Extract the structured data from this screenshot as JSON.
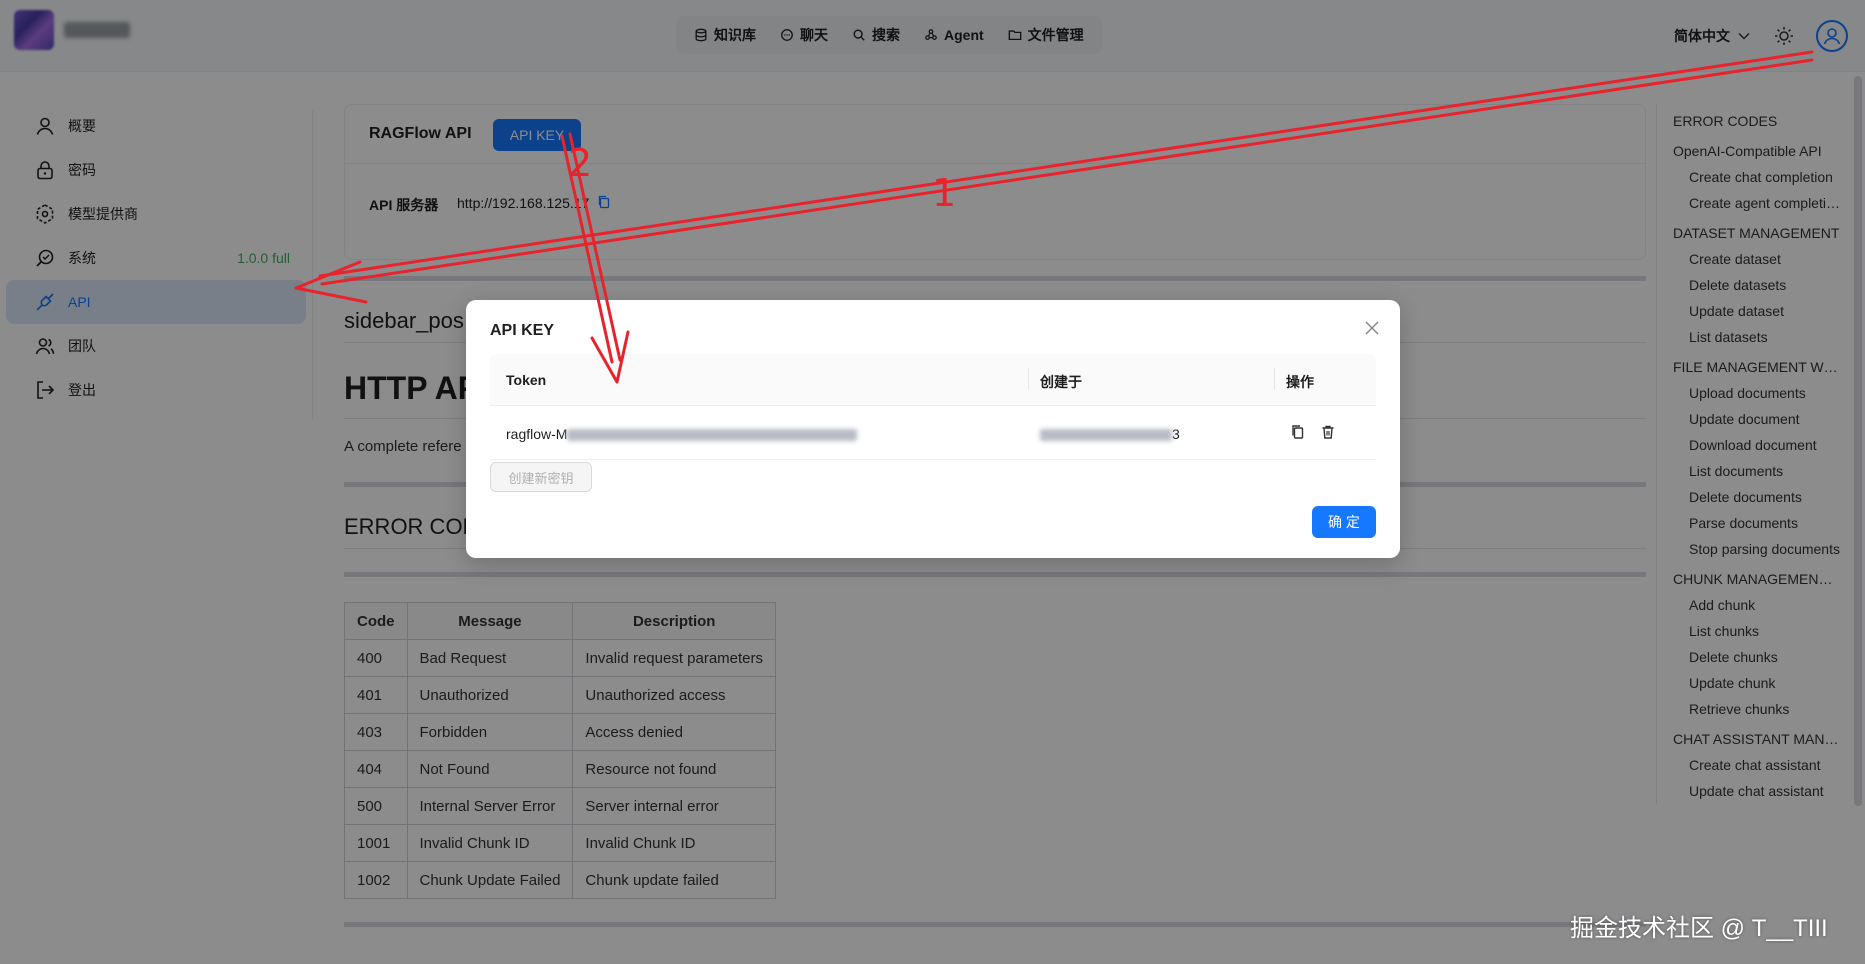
{
  "header": {
    "nav": [
      {
        "label": "知识库",
        "icon": "database-icon"
      },
      {
        "label": "聊天",
        "icon": "chat-icon"
      },
      {
        "label": "搜索",
        "icon": "search-icon"
      },
      {
        "label": "Agent",
        "icon": "agent-icon"
      },
      {
        "label": "文件管理",
        "icon": "folder-icon"
      }
    ],
    "language": "简体中文"
  },
  "sidebar": {
    "items": [
      {
        "label": "概要",
        "icon": "user-icon"
      },
      {
        "label": "密码",
        "icon": "lock-icon"
      },
      {
        "label": "模型提供商",
        "icon": "model-icon"
      },
      {
        "label": "系统",
        "icon": "system-icon",
        "badge": "1.0.0 full"
      },
      {
        "label": "API",
        "icon": "api-icon",
        "active": true
      },
      {
        "label": "团队",
        "icon": "team-icon"
      },
      {
        "label": "登出",
        "icon": "logout-icon"
      }
    ]
  },
  "api_card": {
    "title": "RAGFlow API",
    "key_button": "API KEY",
    "server_label": "API 服务器",
    "server_url": "http://192.168.125.17"
  },
  "content": {
    "sidebar_heading": "sidebar_pos",
    "http_heading": "HTTP AP",
    "intro": "A complete refere",
    "error_heading": "ERROR COD",
    "table": {
      "headers": [
        "Code",
        "Message",
        "Description"
      ],
      "rows": [
        [
          "400",
          "Bad Request",
          "Invalid request parameters"
        ],
        [
          "401",
          "Unauthorized",
          "Unauthorized access"
        ],
        [
          "403",
          "Forbidden",
          "Access denied"
        ],
        [
          "404",
          "Not Found",
          "Resource not found"
        ],
        [
          "500",
          "Internal Server Error",
          "Server internal error"
        ],
        [
          "1001",
          "Invalid Chunk ID",
          "Invalid Chunk ID"
        ],
        [
          "1002",
          "Chunk Update Failed",
          "Chunk update failed"
        ]
      ]
    }
  },
  "toc": [
    {
      "label": "ERROR CODES",
      "level": 0
    },
    {
      "label": "OpenAI-Compatible API",
      "level": 0
    },
    {
      "label": "Create chat completion",
      "level": 1
    },
    {
      "label": "Create agent completion",
      "level": 1
    },
    {
      "label": "DATASET MANAGEMENT",
      "level": 0
    },
    {
      "label": "Create dataset",
      "level": 1
    },
    {
      "label": "Delete datasets",
      "level": 1
    },
    {
      "label": "Update dataset",
      "level": 1
    },
    {
      "label": "List datasets",
      "level": 1
    },
    {
      "label": "FILE MANAGEMENT WITHIN DATASET",
      "level": 0
    },
    {
      "label": "Upload documents",
      "level": 1
    },
    {
      "label": "Update document",
      "level": 1
    },
    {
      "label": "Download document",
      "level": 1
    },
    {
      "label": "List documents",
      "level": 1
    },
    {
      "label": "Delete documents",
      "level": 1
    },
    {
      "label": "Parse documents",
      "level": 1
    },
    {
      "label": "Stop parsing documents",
      "level": 1
    },
    {
      "label": "CHUNK MANAGEMENT WITHIN DATASET",
      "level": 0
    },
    {
      "label": "Add chunk",
      "level": 1
    },
    {
      "label": "List chunks",
      "level": 1
    },
    {
      "label": "Delete chunks",
      "level": 1
    },
    {
      "label": "Update chunk",
      "level": 1
    },
    {
      "label": "Retrieve chunks",
      "level": 1
    },
    {
      "label": "CHAT ASSISTANT MANAGEMENT",
      "level": 0
    },
    {
      "label": "Create chat assistant",
      "level": 1
    },
    {
      "label": "Update chat assistant",
      "level": 1
    }
  ],
  "modal": {
    "title": "API KEY",
    "columns": [
      "Token",
      "创建于",
      "操作"
    ],
    "token_prefix": "ragflow-M",
    "created_suffix": "3",
    "new_key_button": "创建新密钥",
    "ok_button": "确 定"
  },
  "annotations": {
    "marker_1": "1",
    "marker_2": "2",
    "arrow_color": "#e8232d"
  },
  "watermark": "掘金技术社区 @ T__TIII"
}
